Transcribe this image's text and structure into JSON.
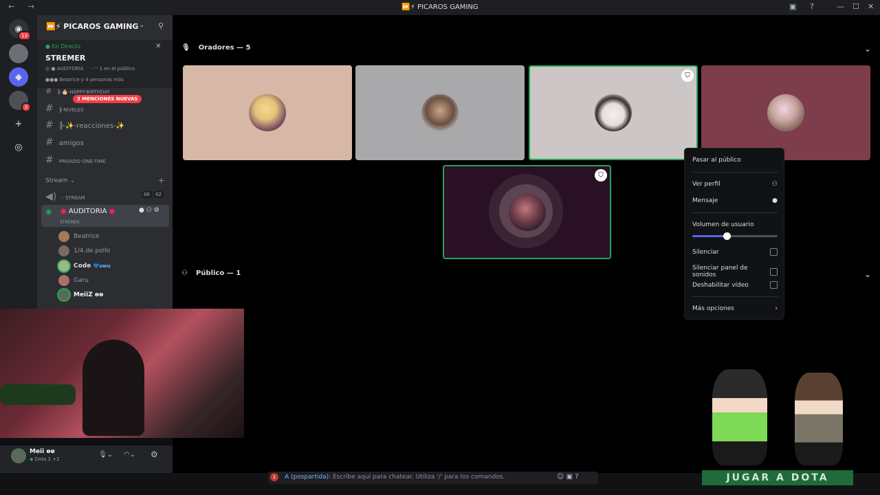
{
  "titlebar": {
    "title": "⏩⚡ PICAROS GAMING",
    "nav": "←  →",
    "icons": [
      "inbox-icon",
      "help-icon"
    ],
    "window": [
      "—",
      "☐",
      "✕"
    ]
  },
  "rail": {
    "badges": {
      "dm": "13",
      "s3": "3"
    }
  },
  "sidebar": {
    "server_name": "⏩⚡ PICAROS GAMING",
    "voice_panel": {
      "status": "En Directo",
      "channel_title": "STREMER",
      "channel_line": "AUDITORIA",
      "audience_line": "1 en el público",
      "members_line": "Beatrice y 4 personas más"
    },
    "mentions_pill": "3 MENCIONES NUEVAS",
    "channels": [
      "╠-🎂-HAPPY-BIRTHDAY",
      "╠-NIVELES",
      "╠-✨-reacciones-✨",
      "amigos",
      "PRIVADO-ONE-TIME"
    ],
    "category": "Stream",
    "stream_channel": "- STREAM",
    "stream_counts": [
      "00",
      "02"
    ],
    "auditoria": "AUDITORIA",
    "auditoria_sub": "STREMER",
    "voice_users": [
      "Beatrice",
      "1/4.de.pollo",
      "Code",
      "Garu",
      "MeiiZ ɵɵ"
    ],
    "code_tag": "💙uwu"
  },
  "main": {
    "speakers_header": "Oradores — 5",
    "audience_header": "Público — 1"
  },
  "context_menu": {
    "move_to_audience": "Pasar al público",
    "view_profile": "Ver perfil",
    "message": "Mensaje",
    "volume_label": "Volumen de usuario",
    "volume_level": 0.4,
    "mute": "Silenciar",
    "mute_soundboard": "Silenciar panel de sonidos",
    "disable_video": "Deshabilitar vídeo",
    "more_options": "Más opciones"
  },
  "userbar": {
    "name": "Meii ɵɵ",
    "activity": "Dota 2 +2"
  },
  "chat": {
    "badge": "1",
    "prefix": "A (pospartida):",
    "placeholder": "Escribe aquí para chatear. Utiliza '/' para los comandos."
  },
  "overlay": {
    "dota_button": "JUGAR A DOTA"
  },
  "colors": {
    "accent": "#5865f2",
    "live": "#23a55a",
    "mention": "#f23f43"
  }
}
